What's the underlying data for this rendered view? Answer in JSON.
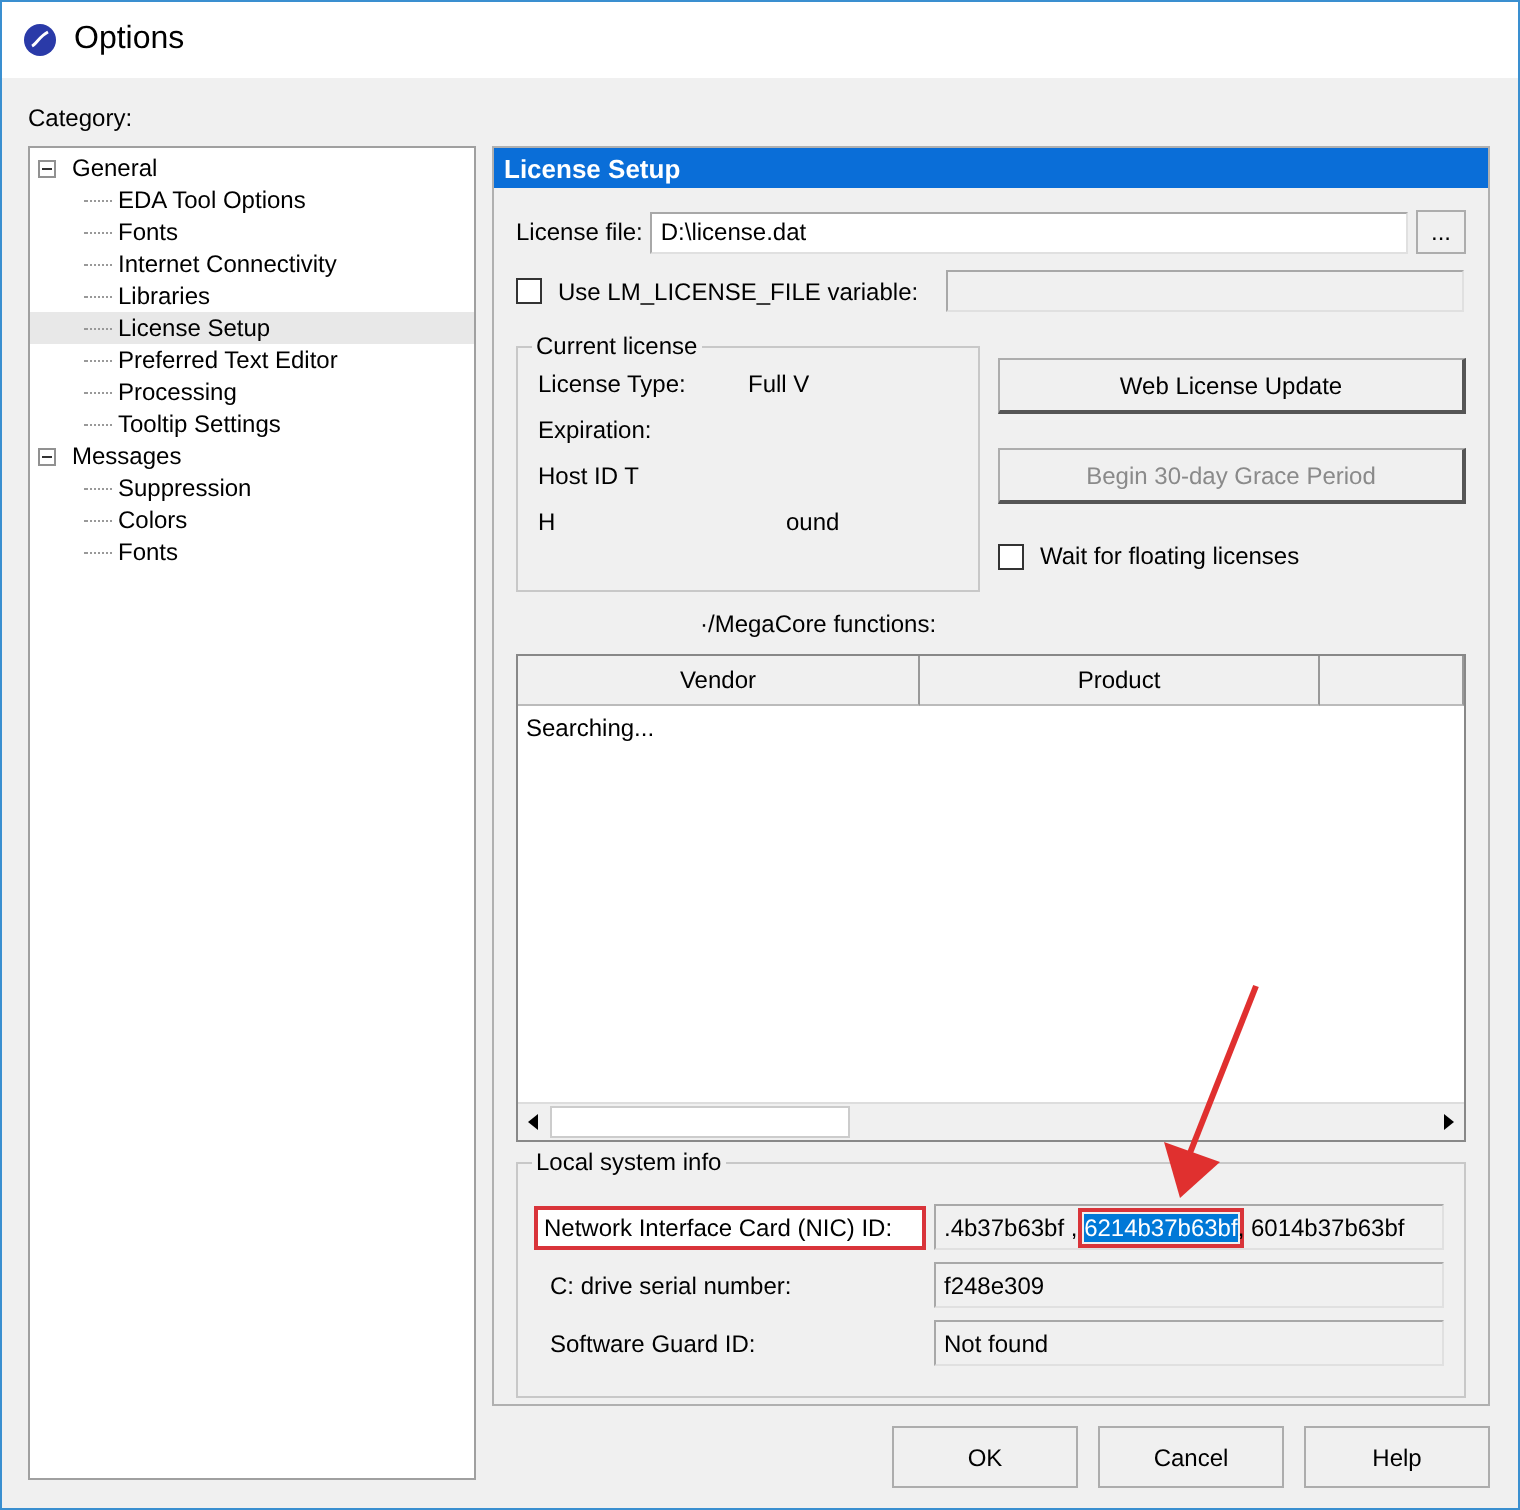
{
  "window": {
    "title": "Options"
  },
  "category_label": "Category:",
  "tree": [
    {
      "label": "General",
      "expanded": true,
      "selected": false,
      "children": [
        {
          "label": "EDA Tool Options",
          "selected": false
        },
        {
          "label": "Fonts",
          "selected": false
        },
        {
          "label": "Internet Connectivity",
          "selected": false
        },
        {
          "label": "Libraries",
          "selected": false
        },
        {
          "label": "License Setup",
          "selected": true
        },
        {
          "label": "Preferred Text Editor",
          "selected": false
        },
        {
          "label": "Processing",
          "selected": false
        },
        {
          "label": "Tooltip Settings",
          "selected": false
        }
      ]
    },
    {
      "label": "Messages",
      "expanded": true,
      "selected": false,
      "children": [
        {
          "label": "Suppression",
          "selected": false
        },
        {
          "label": "Colors",
          "selected": false
        },
        {
          "label": "Fonts",
          "selected": false
        }
      ]
    }
  ],
  "panel": {
    "title": "License Setup",
    "license_file": {
      "label": "License file:",
      "value": "D:\\license.dat",
      "browse": "..."
    },
    "use_env": {
      "label": "Use LM_LICENSE_FILE variable:",
      "checked": false
    },
    "current_license": {
      "title": "Current license",
      "rows": [
        {
          "label": "License Type:",
          "value": "Full V"
        },
        {
          "label": "Expiration:"
        },
        {
          "label": "Host ID T"
        },
        {
          "label": "H",
          "value": "ound"
        }
      ]
    },
    "buttons": [
      {
        "label": "Web License Update",
        "disabled": false
      },
      {
        "label": "Begin 30-day Grace Period",
        "disabled": true
      }
    ],
    "wait_floating": {
      "label": "Wait for floating licenses",
      "checked": false
    },
    "functions_label": "·/MegaCore functions:",
    "table": {
      "columns": [
        "Vendor",
        "Product"
      ],
      "status": "Searching..."
    },
    "local_info": {
      "title": "Local system info",
      "rows": [
        {
          "label": "Network Interface Card (NIC) ID:",
          "highlighted": true,
          "parts": [
            {
              "text": ".4b37b63bf , ",
              "selected": false
            },
            {
              "text": "6214b37b63bf",
              "selected": true
            },
            {
              "text": ", 6014b37b63bf",
              "selected": false
            }
          ]
        },
        {
          "label": "C: drive serial number:",
          "highlighted": false,
          "parts": [
            {
              "text": "f248e309",
              "selected": false
            }
          ]
        },
        {
          "label": "Software Guard ID:",
          "highlighted": false,
          "parts": [
            {
              "text": "Not found",
              "selected": false
            }
          ]
        }
      ]
    }
  },
  "footer_buttons": [
    "OK",
    "Cancel",
    "Help"
  ]
}
